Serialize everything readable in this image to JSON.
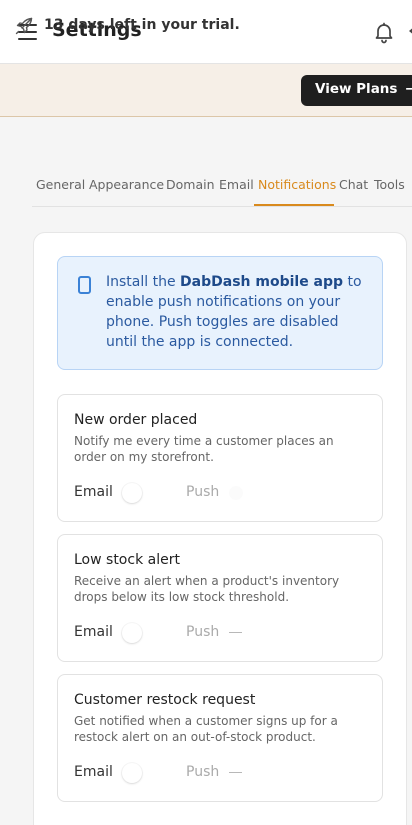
{
  "header": {
    "title": "Settings",
    "icons": {
      "menu": "hamburger-menu-icon",
      "notifications": "bell-icon"
    }
  },
  "trial": {
    "message": "13 days left in your trial.",
    "icon": "rocket-icon",
    "cta_label": "View Plans",
    "cta_arrow": "→"
  },
  "tabs": [
    {
      "label": "General"
    },
    {
      "label": "Appearance"
    },
    {
      "label": "Domain"
    },
    {
      "label": "Email"
    },
    {
      "label": "Notifications",
      "active": true
    },
    {
      "label": "Chat"
    },
    {
      "label": "Tools"
    }
  ],
  "info": {
    "icon": "mobile-phone-icon",
    "text_before": "Install the ",
    "app_name": "DabDash mobile app",
    "text_after": " to enable push notifications on your phone. Push toggles are disabled until the app is connected."
  },
  "notifications": [
    {
      "title": "New order placed",
      "description": "Notify me every time a customer places an order on my storefront.",
      "email_label": "Email",
      "push_label": "Push",
      "email_enabled": false,
      "push_enabled": false
    },
    {
      "title": "Low stock alert",
      "description": "Receive an alert when a product's inventory drops below its low stock threshold.",
      "email_label": "Email",
      "push_label": "Push",
      "email_enabled": false,
      "push_enabled": false
    },
    {
      "title": "Customer restock request",
      "description": "Get notified when a customer signs up for a restock alert on an out-of-stock product.",
      "email_label": "Email",
      "push_label": "Push",
      "email_enabled": false,
      "push_enabled": false
    }
  ],
  "colors": {
    "accent": "#d98a1d",
    "info_bg": "#e8f2fd",
    "info_text": "#2b5aa0",
    "cta_bg": "#1f1f1f",
    "trial_bg": "#f6efe7"
  }
}
